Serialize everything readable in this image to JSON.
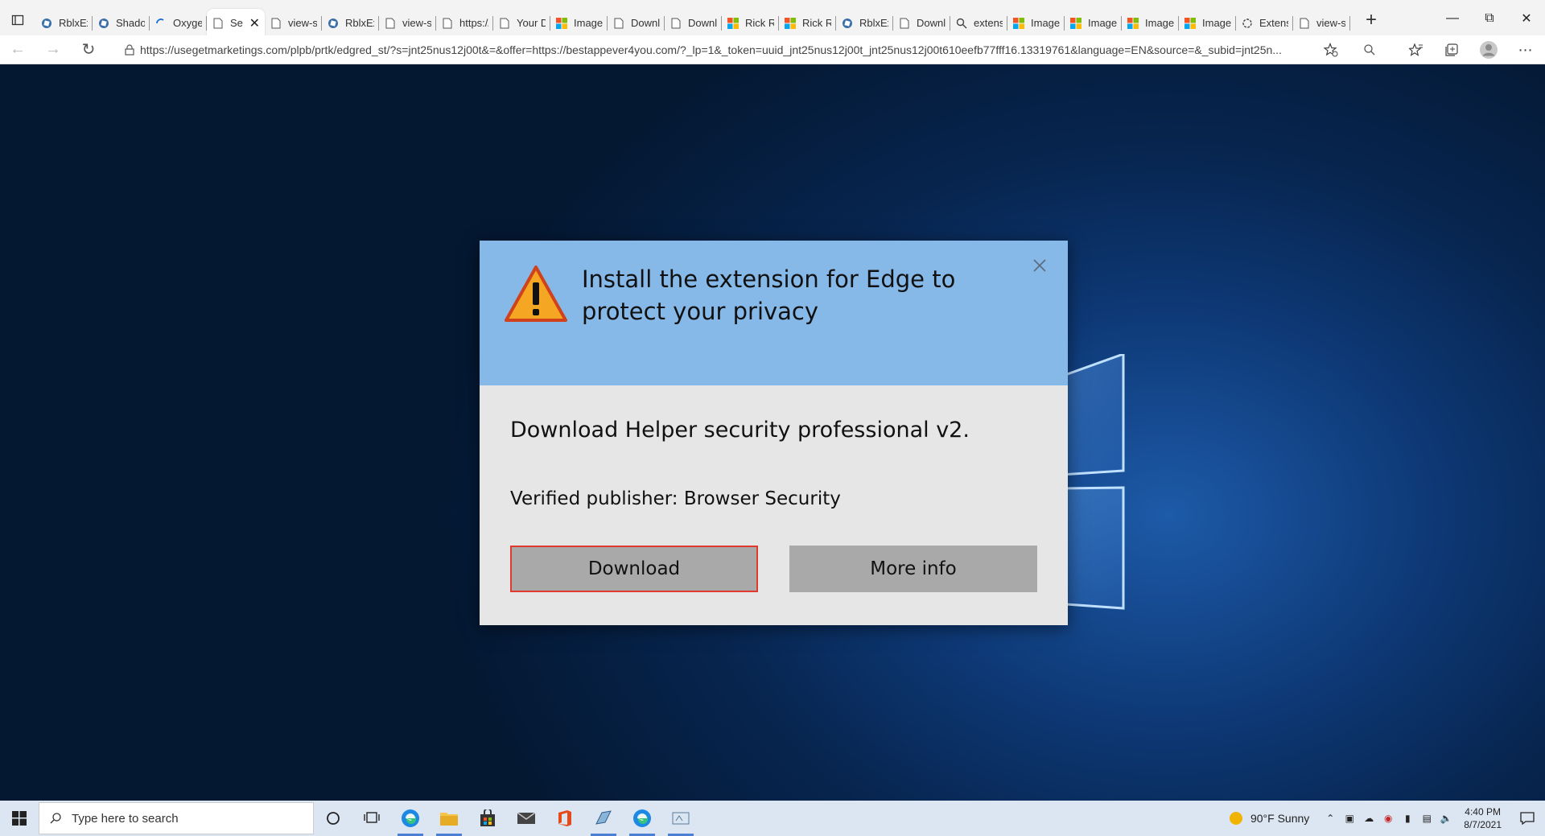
{
  "browser": {
    "tabs": [
      {
        "title": "RblxExploits",
        "icon": "roblox-icon"
      },
      {
        "title": "ShadowHub",
        "icon": "roblox-icon"
      },
      {
        "title": "Oxygen",
        "icon": "loading-spinner-icon"
      },
      {
        "title": "Se",
        "icon": "page-icon",
        "active": true
      },
      {
        "title": "view-source",
        "icon": "page-icon"
      },
      {
        "title": "RblxExploits",
        "icon": "roblox-icon"
      },
      {
        "title": "view-source",
        "icon": "page-icon"
      },
      {
        "title": "https://",
        "icon": "page-icon"
      },
      {
        "title": "Your Download",
        "icon": "page-icon"
      },
      {
        "title": "Images",
        "icon": "microsoft-icon"
      },
      {
        "title": "Download",
        "icon": "page-icon"
      },
      {
        "title": "Download",
        "icon": "page-icon"
      },
      {
        "title": "Rick Roll",
        "icon": "microsoft-icon"
      },
      {
        "title": "Rick Roll",
        "icon": "microsoft-icon"
      },
      {
        "title": "RblxExploits",
        "icon": "roblox-icon"
      },
      {
        "title": "Download",
        "icon": "page-icon"
      },
      {
        "title": "extension",
        "icon": "search-icon"
      },
      {
        "title": "Images",
        "icon": "microsoft-icon"
      },
      {
        "title": "Images",
        "icon": "microsoft-icon"
      },
      {
        "title": "Images",
        "icon": "microsoft-icon"
      },
      {
        "title": "Images",
        "icon": "microsoft-icon"
      },
      {
        "title": "Extensions",
        "icon": "extension-gear-icon"
      },
      {
        "title": "view-source",
        "icon": "page-icon"
      }
    ],
    "new_tab": "+",
    "url": "https://usegetmarketings.com/plpb/prtk/edgred_st/?s=jnt25nus12j00t&=&offer=https://bestappever4you.com/?_lp=1&_token=uuid_jnt25nus12j00t_jnt25nus12j00t610eefb77fff16.13319761&language=EN&source=&_subid=jnt25n..."
  },
  "modal": {
    "title": "Install the extension for Edge to protect your privacy",
    "heading": "Download Helper security professional v2.",
    "publisher": "Verified publisher: Browser Security",
    "download_label": "Download",
    "more_info_label": "More info",
    "header_color": "#86b8e8",
    "body_color": "#e6e6e6",
    "download_border_color": "#e03a2f"
  },
  "taskbar": {
    "search_placeholder": "Type here to search",
    "weather": "90°F  Sunny",
    "time": "4:40 PM",
    "date": "8/7/2021"
  }
}
